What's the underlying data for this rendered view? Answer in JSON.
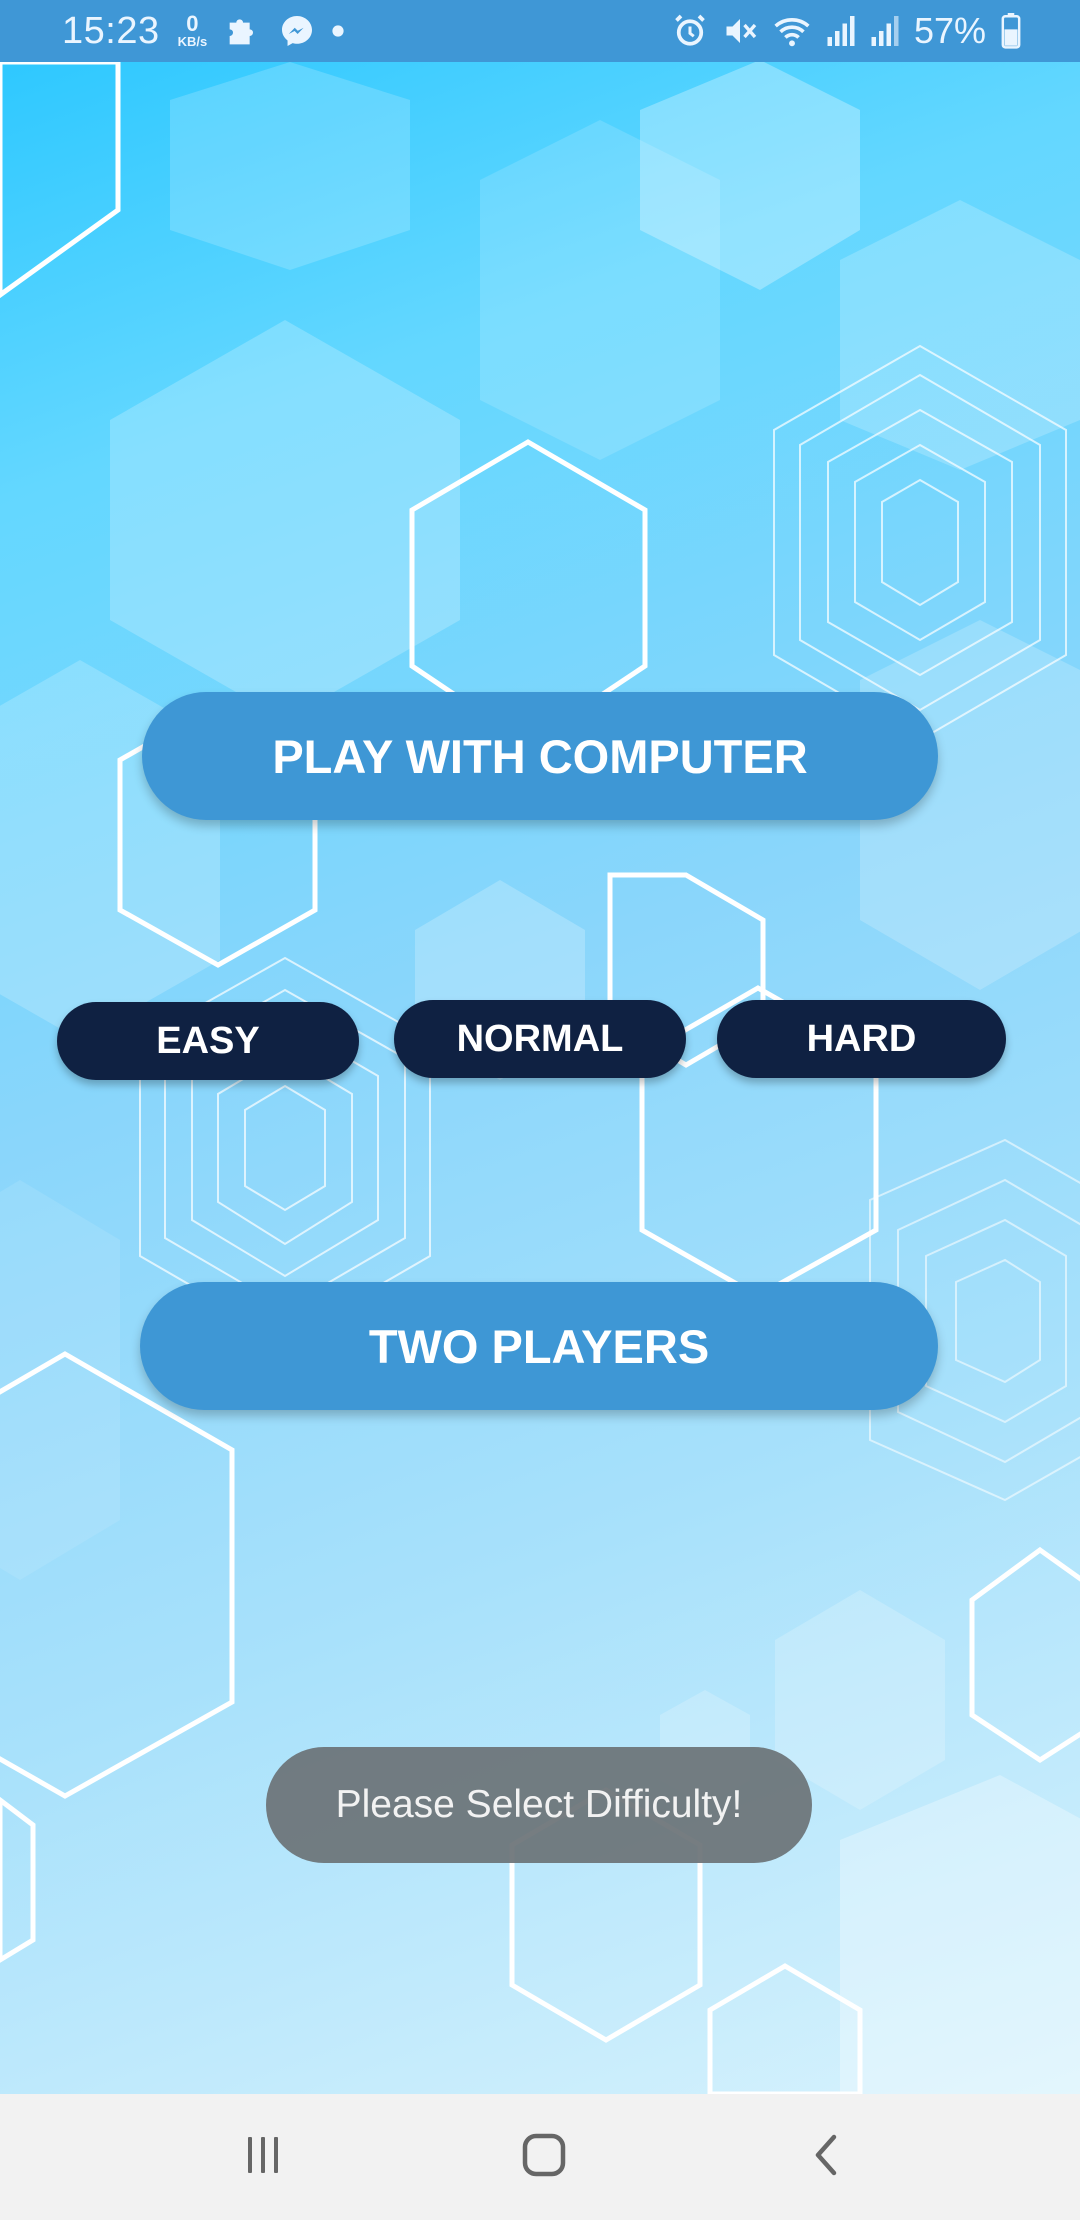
{
  "status_bar": {
    "time": "15:23",
    "net_speed_value": "0",
    "net_speed_unit": "KB/s",
    "battery_percent": "57%",
    "icons": [
      "puzzle-icon",
      "messenger-icon",
      "dot-icon",
      "alarm-icon",
      "mute-icon",
      "wifi-icon",
      "signal-icon",
      "signal-icon",
      "battery-icon"
    ]
  },
  "menu": {
    "play_with_computer": "PLAY WITH COMPUTER",
    "difficulty": {
      "easy": "EASY",
      "normal": "NORMAL",
      "hard": "HARD"
    },
    "two_players": "TWO PLAYERS"
  },
  "toast": {
    "message": "Please Select Difficulty!"
  },
  "nav_bar": {
    "icons": [
      "recent-apps-icon",
      "home-icon",
      "back-icon"
    ]
  },
  "colors": {
    "status_bar": "#3f97d6",
    "primary_button": "#3e97d5",
    "difficulty_button": "#0f2142",
    "toast": "#6c7377",
    "nav_bar": "#f2f2f2"
  }
}
